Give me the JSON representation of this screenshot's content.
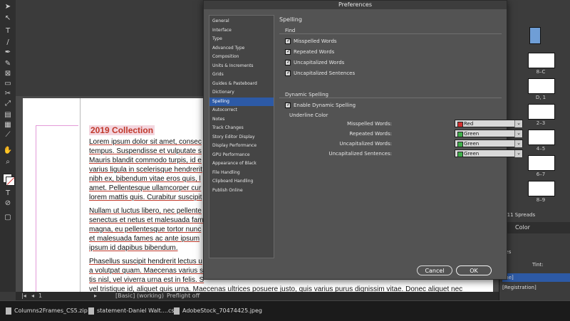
{
  "dialog": {
    "title": "Preferences",
    "categories": [
      "General",
      "Interface",
      "Type",
      "Advanced Type",
      "Composition",
      "Units & Increments",
      "Grids",
      "Guides & Pasteboard",
      "Dictionary",
      "Spelling",
      "Autocorrect",
      "Notes",
      "Track Changes",
      "Story Editor Display",
      "Display Performance",
      "GPU Performance",
      "Appearance of Black",
      "File Handling",
      "Clipboard Handling",
      "Publish Online"
    ],
    "selected_index": 9,
    "panel_title": "Spelling",
    "find": {
      "label": "Find",
      "options": [
        {
          "label": "Misspelled Words",
          "checked": true
        },
        {
          "label": "Repeated Words",
          "checked": true
        },
        {
          "label": "Uncapitalized Words",
          "checked": true
        },
        {
          "label": "Uncapitalized Sentences",
          "checked": true
        }
      ]
    },
    "dynamic": {
      "label": "Dynamic Spelling",
      "enable_label": "Enable Dynamic Spelling",
      "enable_checked": true,
      "underline_label": "Underline Color",
      "rows": [
        {
          "label": "Misspelled Words:",
          "value": "Red",
          "color": "#d32f2f"
        },
        {
          "label": "Repeated Words:",
          "value": "Green",
          "color": "#3fae49"
        },
        {
          "label": "Uncapitalized Words:",
          "value": "Green",
          "color": "#3fae49"
        },
        {
          "label": "Uncapitalized Sentences:",
          "value": "Green",
          "color": "#3fae49"
        }
      ]
    },
    "buttons": {
      "cancel": "Cancel",
      "ok": "OK"
    }
  },
  "document": {
    "title": "2019 Collection",
    "paragraphs": [
      "Lorem ipsum dolor sit amet, consec\ntempus. Suspendisse et vulputate s\nMauris blandit commodo turpis, id e\nvarius ligula in scelerisque hendrerit\nnibh ex, bibendum vitae eros quis, l\namet. Pellentesque ullamcorper cur\nlorem mattis quis. Curabitur suscipit",
      "Nullam ut luctus libero, nec pellente\nsenectus et netus et malesuada fam\nmagna, eu pellentesque tortor nunc\net malesuada fames ac ante ipsum\nipsum id dapibus bibendum.",
      "Phasellus suscipit hendrerit lectus u\na volutpat quam. Maecenas varius s\ntis nisl, vel viverra urna est in felis. S\nvel tristique id, aliquet quis urna. Maecenas ultrices posuere justo, quis varius purus dignissim vitae. Donec aliquet nec\nmassa ac efficitur. Etiam ac rutrum urna, non consequat erat. Pellentesque ut imperdiet ligula. Nulla in dictum Maece"
    ]
  },
  "statusbar": {
    "page": "1",
    "style": "[Basic] (working)",
    "preflight": "Preflight off"
  },
  "pages_panel": {
    "labels": [
      "8–C",
      "D, 1",
      "2–3",
      "4–5",
      "6–7",
      "8–9"
    ],
    "spreads": "n 11 Spreads",
    "color_tab": "Color",
    "swatches_label": "nes",
    "tint_label": "Tint:",
    "row1": "one]",
    "row2": "[Registration]"
  },
  "taskbar": {
    "items": [
      "Columns2Frames_CS5.zip",
      "statement-Daniel Walt....csv",
      "AdobeStock_70474425.jpeg"
    ]
  },
  "colors": {
    "selected": "#2d5aa6",
    "dialog_bg": "#535353",
    "title_red": "#c0392b"
  }
}
